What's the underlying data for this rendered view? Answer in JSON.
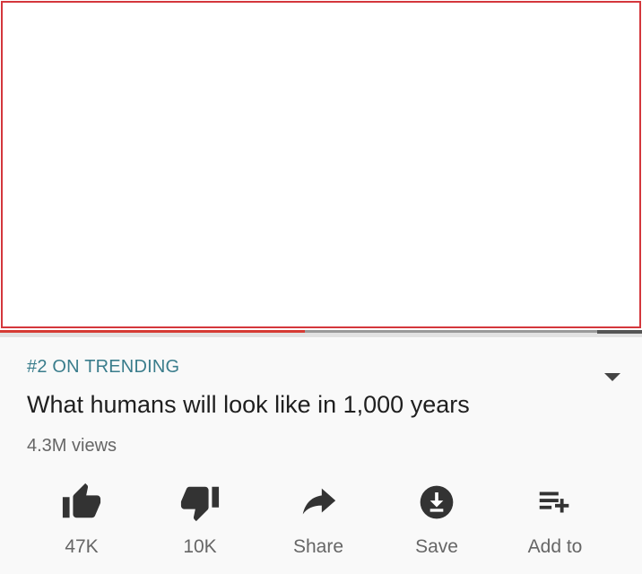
{
  "player": {
    "progress": 0.51
  },
  "video": {
    "trending_label": "#2 ON TRENDING",
    "title": "What humans will look like in 1,000 years",
    "views": "4.3M views"
  },
  "actions": [
    {
      "icon": "thumbs-up-icon",
      "label": "47K"
    },
    {
      "icon": "thumbs-down-icon",
      "label": "10K"
    },
    {
      "icon": "share-arrow-icon",
      "label": "Share"
    },
    {
      "icon": "download-icon",
      "label": "Save"
    },
    {
      "icon": "playlist-add-icon",
      "label": "Add to"
    }
  ],
  "colors": {
    "trending": "#3a7d8c",
    "progress": "#d63b34",
    "icon": "#333333"
  }
}
